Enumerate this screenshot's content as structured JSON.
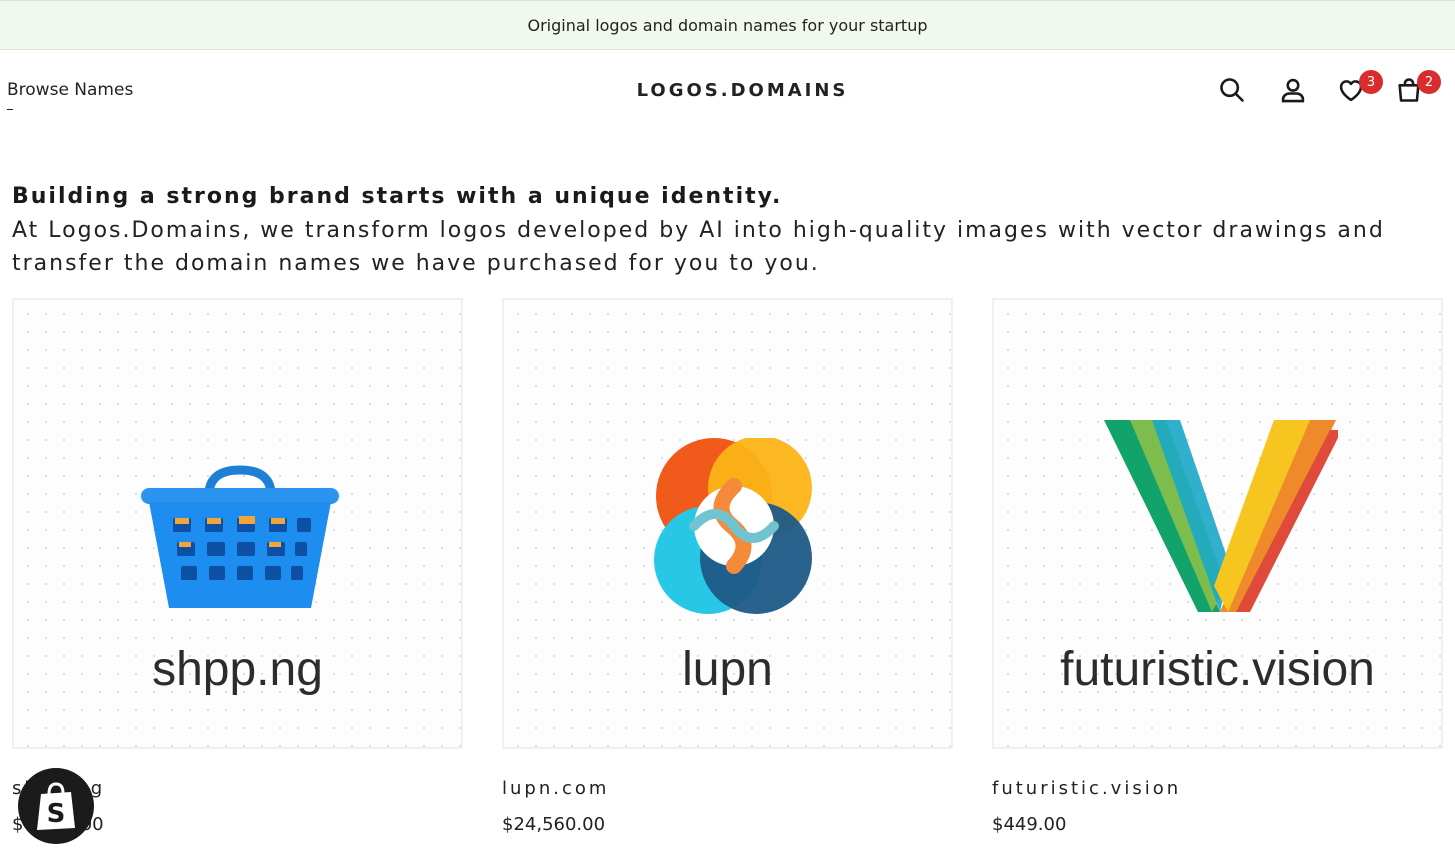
{
  "announcement": "Original logos and domain names for your startup",
  "header": {
    "browse_label": "Browse Names",
    "logo_text": "LOGOS.DOMAINS",
    "wishlist_count": "3",
    "cart_count": "2"
  },
  "intro": {
    "heading": "Building a strong brand starts with a unique identity.",
    "body": "At Logos.Domains, we transform logos developed by AI into high-quality images with vector drawings and transfer the domain names we have purchased for you to you."
  },
  "products": [
    {
      "image_text": "shpp.ng",
      "title": "shpp.ng",
      "price": "$4,270.00"
    },
    {
      "image_text": "lupn",
      "title": "lupn.com",
      "price": "$24,560.00"
    },
    {
      "image_text": "futuristic.vision",
      "title": "futuristic.vision",
      "price": "$449.00"
    }
  ],
  "colors": {
    "accent": "#d92d2d",
    "announce_bg": "#f1f9ee"
  }
}
